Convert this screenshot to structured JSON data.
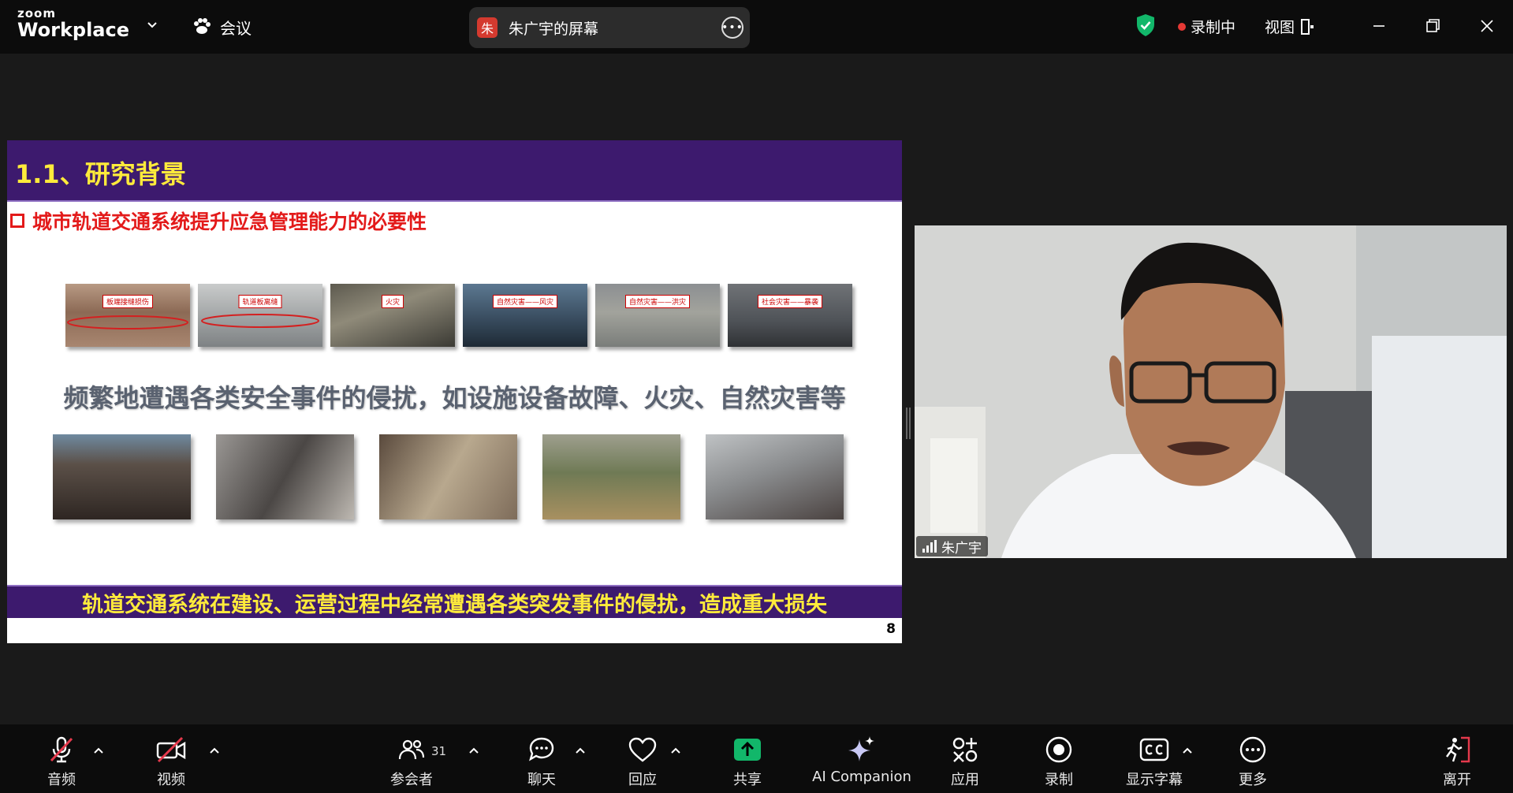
{
  "app": {
    "logo_line1": "zoom",
    "logo_line2": "Workplace",
    "meeting_menu": "会议"
  },
  "share_pill": {
    "avatar_char": "朱",
    "label": "朱广宇的屏幕"
  },
  "status": {
    "recording": "录制中",
    "view": "视图"
  },
  "slide": {
    "title": "1.1、研究背景",
    "subtitle": "城市轨道交通系统提升应急管理能力的必要性",
    "row1_tags": [
      "板端接缝损伤",
      "轨道板离缝",
      "火灾",
      "自然灾害——风灾",
      "自然灾害——洪灾",
      "社会灾害——暴袭"
    ],
    "caption": "频繁地遭遇各类安全事件的侵扰，如设施设备故障、火灾、自然灾害等",
    "footer": "轨道交通系统在建设、运营过程中经常遭遇各类突发事件的侵扰，造成重大损失",
    "page_number": "8"
  },
  "video": {
    "participant_name": "朱广宇"
  },
  "toolbar": {
    "audio": "音频",
    "video": "视频",
    "participants": "参会者",
    "participants_count": "31",
    "chat": "聊天",
    "react": "回应",
    "share": "共享",
    "ai": "AI Companion",
    "apps": "应用",
    "record": "录制",
    "captions": "显示字幕",
    "more": "更多",
    "leave": "离开"
  },
  "colors": {
    "slide_band": "#3d1a6e",
    "slide_title": "#ffeb3b",
    "subtitle_red": "#e31a1a",
    "share_green": "#12b76a",
    "mute_red": "#e5394c"
  }
}
